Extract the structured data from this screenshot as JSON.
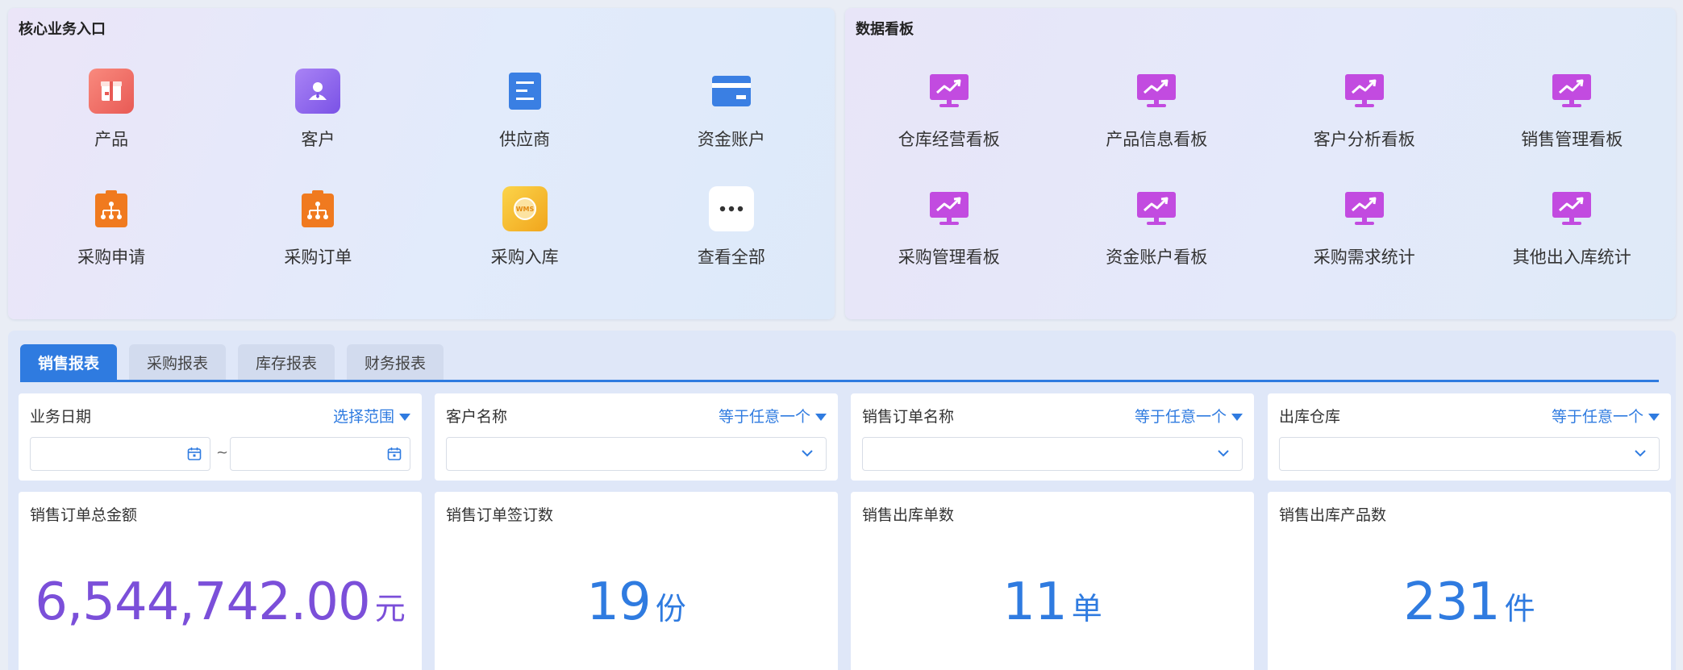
{
  "core": {
    "title": "核心业务入口",
    "items": [
      {
        "label": "产品",
        "icon": "product-box-icon"
      },
      {
        "label": "客户",
        "icon": "customer-person-icon"
      },
      {
        "label": "供应商",
        "icon": "supplier-document-icon"
      },
      {
        "label": "资金账户",
        "icon": "bank-card-icon"
      },
      {
        "label": "采购申请",
        "icon": "org-chart-clipboard-icon"
      },
      {
        "label": "采购订单",
        "icon": "org-chart-clipboard-icon"
      },
      {
        "label": "采购入库",
        "icon": "wms-badge-icon",
        "badge_text": "WMS"
      },
      {
        "label": "查看全部",
        "icon": "more-dots-icon"
      }
    ]
  },
  "boards": {
    "title": "数据看板",
    "items": [
      {
        "label": "仓库经营看板"
      },
      {
        "label": "产品信息看板"
      },
      {
        "label": "客户分析看板"
      },
      {
        "label": "销售管理看板"
      },
      {
        "label": "采购管理看板"
      },
      {
        "label": "资金账户看板"
      },
      {
        "label": "采购需求统计"
      },
      {
        "label": "其他出入库统计"
      }
    ],
    "icon": "monitor-chart-icon"
  },
  "tabs": [
    {
      "label": "销售报表",
      "active": true
    },
    {
      "label": "采购报表",
      "active": false
    },
    {
      "label": "库存报表",
      "active": false
    },
    {
      "label": "财务报表",
      "active": false
    }
  ],
  "filters": [
    {
      "name": "业务日期",
      "mode": "选择范围",
      "type": "date-range",
      "separator": "~"
    },
    {
      "name": "客户名称",
      "mode": "等于任意一个",
      "type": "select"
    },
    {
      "name": "销售订单名称",
      "mode": "等于任意一个",
      "type": "select"
    },
    {
      "name": "出库仓库",
      "mode": "等于任意一个",
      "type": "select"
    }
  ],
  "kpis": [
    {
      "name": "销售订单总金额",
      "value": "6,544,742.00",
      "unit": "元",
      "color": "#7b4fd9"
    },
    {
      "name": "销售订单签订数",
      "value": "19",
      "unit": "份",
      "color": "#2f7be0"
    },
    {
      "name": "销售出库单数",
      "value": "11",
      "unit": "单",
      "color": "#2f7be0"
    },
    {
      "name": "销售出库产品数",
      "value": "231",
      "unit": "件",
      "color": "#2f7be0"
    }
  ],
  "colors": {
    "accent": "#2f7be0",
    "board_icon": "#c24be0",
    "orange_icon": "#f07a1f"
  }
}
